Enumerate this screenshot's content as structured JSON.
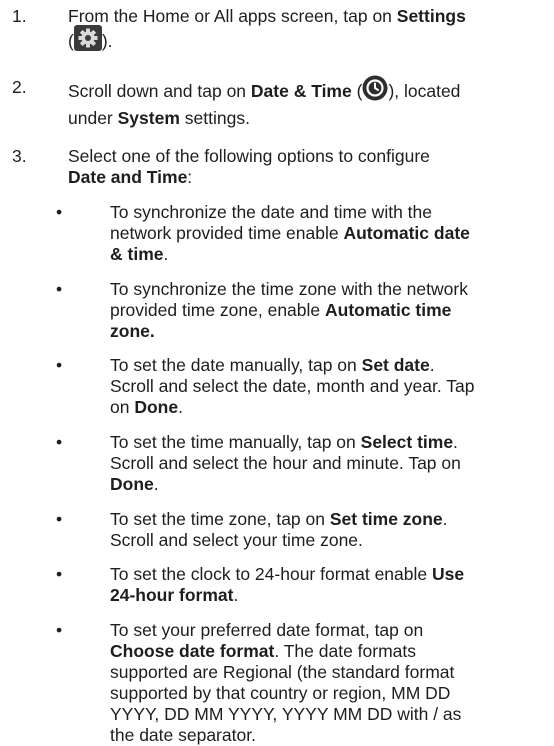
{
  "steps": [
    {
      "num": "1.",
      "settings_pre": "From the Home or All apps screen, tap on ",
      "settings_bold": "Settings",
      "settings_icon": "gear-icon"
    },
    {
      "num": "2.",
      "a": "Scroll down and tap on ",
      "b": "Date & Time",
      "c": " (",
      "clock_icon": "clock-icon",
      "d": "), located",
      "e": "under ",
      "f": "System",
      "g": " settings."
    },
    {
      "num": "3.",
      "a": "Select one of the following options to configure",
      "b": "Date and Time",
      "c": ":"
    }
  ],
  "bullets": [
    {
      "dot": "•",
      "l1": "To synchronize the date and time with the",
      "l2a": "network provided time enable ",
      "l2b": "Automatic date",
      "l3": "& time",
      "l3c": "."
    },
    {
      "dot": "•",
      "l1": "To synchronize the time zone with the network",
      "l2a": "provided time zone, enable ",
      "l2b": "Automatic time",
      "l3": "zone."
    },
    {
      "dot": "•",
      "l1a": "To set the date manually, tap on ",
      "l1b": "Set date",
      "l1c": ".",
      "l2": "Scroll and select the date, month and year. Tap",
      "l3a": "on ",
      "l3b": "Done",
      "l3c": "."
    },
    {
      "dot": "•",
      "l1a": "To set the time manually, tap on ",
      "l1b": "Select time",
      "l1c": ".",
      "l2": "Scroll and select the hour and minute. Tap on",
      "l3b": "Done",
      "l3c": "."
    },
    {
      "dot": "•",
      "l1a": "To set the time zone, tap on ",
      "l1b": "Set time zone",
      "l1c": ".",
      "l2": "Scroll and select your time zone."
    },
    {
      "dot": "•",
      "l1a": "To set the clock to 24-hour format enable ",
      "l1b": "Use",
      "l2b": "24-hour format",
      "l2c": "."
    },
    {
      "dot": "•",
      "l1": "To set your preferred date format, tap on",
      "l2b": "Choose date format",
      "l2c": ". The date formats",
      "l3": "supported are Regional (the standard format",
      "l4": "supported by that country or region, MM DD",
      "l5": "YYYY, DD MM YYYY, YYYY MM DD with / as",
      "l6": "the date separator."
    }
  ],
  "colors": {
    "text": "#1e1e1e",
    "icon_dark": "#2e2e2e",
    "icon_light": "#ffffff"
  }
}
